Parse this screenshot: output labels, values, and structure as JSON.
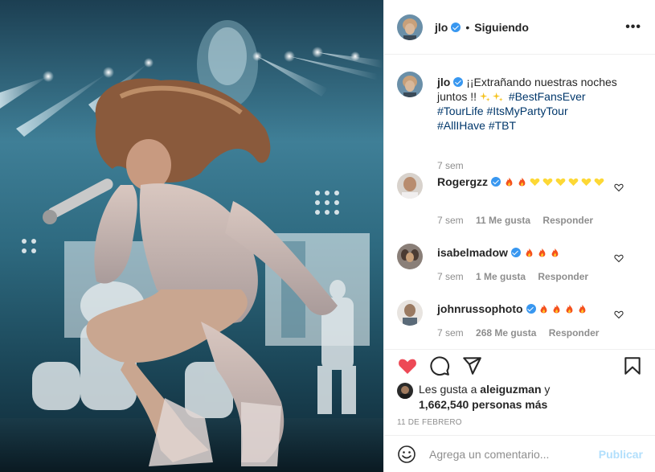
{
  "header": {
    "username": "jlo",
    "separator": "•",
    "follow_label": "Siguiendo",
    "more_label": "•••"
  },
  "caption": {
    "username": "jlo",
    "text": "¡¡Extrañando nuestras noches juntos !!",
    "hashtags": [
      "#BestFansEver",
      "#TourLife",
      "#ItsMyPartyTour",
      "#AllIHave",
      "#TBT"
    ],
    "time": "7 sem"
  },
  "comments": [
    {
      "username": "Rogergzz",
      "emoji": [
        "fire",
        "fire",
        "yellow-heart",
        "yellow-heart",
        "yellow-heart",
        "yellow-heart",
        "yellow-heart",
        "yellow-heart"
      ],
      "time": "7 sem",
      "likes": "11 Me gusta",
      "reply": "Responder"
    },
    {
      "username": "isabelmadow",
      "emoji": [
        "fire",
        "fire",
        "fire"
      ],
      "time": "7 sem",
      "likes": "1 Me gusta",
      "reply": "Responder"
    },
    {
      "username": "johnrussophoto",
      "emoji": [
        "fire",
        "fire",
        "fire",
        "fire"
      ],
      "time": "7 sem",
      "likes": "268 Me gusta",
      "reply": "Responder"
    }
  ],
  "likes": {
    "prefix": "Les gusta a",
    "user": "aleiguzman",
    "suffix": "y",
    "count_line": "1,662,540 personas más"
  },
  "date": "11 DE FEBRERO",
  "add_comment": {
    "placeholder": "Agrega un comentario...",
    "publish_label": "Publicar"
  },
  "colors": {
    "verified": "#3897f0",
    "liked_heart": "#ed4956",
    "hashtag": "#00376b",
    "muted": "#8e8e8e",
    "publish_disabled": "#b2dffc"
  },
  "icons": [
    "verified-badge-icon",
    "more-options-icon",
    "heart-outline-icon",
    "heart-filled-icon",
    "comment-icon",
    "share-icon",
    "bookmark-icon",
    "emoji-icon",
    "sparkles-icon",
    "fire-icon",
    "yellow-heart-icon"
  ]
}
